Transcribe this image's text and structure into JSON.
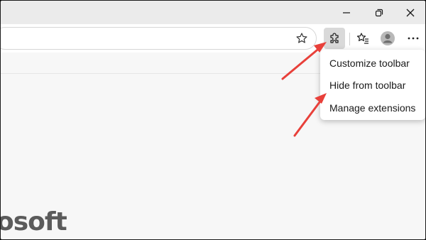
{
  "window_controls": {
    "minimize_icon": "minimize-icon",
    "restore_icon": "restore-icon",
    "close_icon": "close-icon"
  },
  "toolbar": {
    "favorite_icon": "star-icon",
    "extensions_icon": "puzzle-piece-icon",
    "favorites_icon": "favorites-list-icon",
    "profile_icon": "avatar-icon",
    "more_icon": "more-dots-icon"
  },
  "context_menu": {
    "items": [
      {
        "label": "Customize toolbar"
      },
      {
        "label": "Hide from toolbar"
      },
      {
        "label": "Manage extensions"
      }
    ]
  },
  "page": {
    "brand_text": "osoft"
  },
  "annotations": {
    "arrow_color": "#e8403a"
  }
}
